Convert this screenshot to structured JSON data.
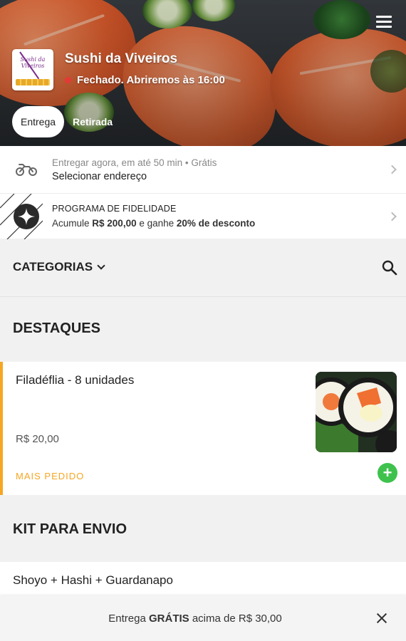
{
  "hero": {
    "store_name": "Sushi da Viveiros",
    "status_text": "Fechado. Abriremos às 16:00",
    "status_color": "#e53935",
    "logo_text": "Sushi da Viveiros",
    "menu_icon": "hamburger-menu-icon"
  },
  "tabs": [
    {
      "label": "Entrega",
      "active": true
    },
    {
      "label": "Retirada",
      "active": false
    }
  ],
  "delivery": {
    "icon": "motorcycle-icon",
    "line1": "Entregar agora, em até 50 min • Grátis",
    "line2": "Selecionar endereço"
  },
  "loyalty": {
    "icon": "sparkle-star-icon",
    "title": "PROGRAMA DE FIDELIDADE",
    "sub_prefix": "Acumule ",
    "sub_amount": "R$ 200,00",
    "sub_middle": " e ganhe ",
    "sub_reward": "20% de desconto"
  },
  "categories": {
    "label": "CATEGORIAS",
    "search_icon": "search-icon"
  },
  "sections": {
    "highlights_title": "DESTAQUES",
    "kit_title": "KIT PARA ENVIO"
  },
  "products": {
    "featured": {
      "name": "Filadéflia - 8 unidades",
      "price": "R$ 20,00",
      "tag": "MAIS PEDIDO",
      "add_label": "+"
    },
    "kit_item": {
      "name": "Shoyo + Hashi + Guardanapo"
    }
  },
  "banner": {
    "prefix": "Entrega ",
    "highlight": "GRÁTIS",
    "suffix": " acima de R$ 30,00",
    "close_icon": "close-icon"
  },
  "colors": {
    "accent": "#f5a623",
    "add_button": "#3ec24d",
    "closed_dot": "#e53935"
  }
}
